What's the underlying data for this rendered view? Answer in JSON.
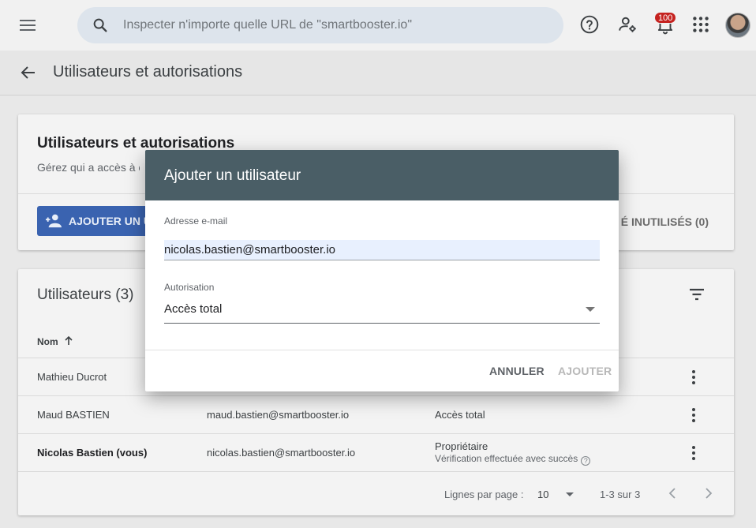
{
  "topbar": {
    "search_placeholder": "Inspecter n'importe quelle URL de \"smartbooster.io\"",
    "notifications_count": "100"
  },
  "page": {
    "title": "Utilisateurs et autorisations"
  },
  "permissions_card": {
    "title": "Utilisateurs et autorisations",
    "subtitle": "Gérez qui a accès à c",
    "add_user_label": "AJOUTER UN U",
    "unused_label": "É INUTILISÉS (0)"
  },
  "users_card": {
    "title": "Utilisateurs (3)",
    "column_name": "Nom",
    "rows": [
      {
        "name": "Mathieu Ducrot",
        "email": "",
        "permission": "",
        "note": ""
      },
      {
        "name": "Maud BASTIEN",
        "email": "maud.bastien@smartbooster.io",
        "permission": "Accès total",
        "note": ""
      },
      {
        "name": "Nicolas Bastien (vous)",
        "email": "nicolas.bastien@smartbooster.io",
        "permission": "Propriétaire",
        "note": "Vérification effectuée avec succès"
      }
    ],
    "pager": {
      "rows_per_page_label": "Lignes par page :",
      "rows_per_page_value": "10",
      "range": "1-3 sur 3"
    }
  },
  "dialog": {
    "title": "Ajouter un utilisateur",
    "email_label": "Adresse e-mail",
    "email_value": "nicolas.bastien@smartbooster.io",
    "permission_label": "Autorisation",
    "permission_value": "Accès total",
    "cancel_label": "ANNULER",
    "confirm_label": "AJOUTER"
  },
  "icons": {
    "menu": "menu-icon",
    "search": "search-icon",
    "help": "help-icon",
    "admin": "manage-accounts-icon",
    "notifications": "bell-icon",
    "apps": "apps-grid-icon",
    "back": "arrow-back-icon",
    "filter": "filter-icon",
    "more": "more-vert-icon"
  },
  "colors": {
    "dialog_header": "#4a5e66",
    "primary_button": "#3a63b0",
    "badge": "#c5221f",
    "email_field_bg": "#e8f0fe"
  }
}
